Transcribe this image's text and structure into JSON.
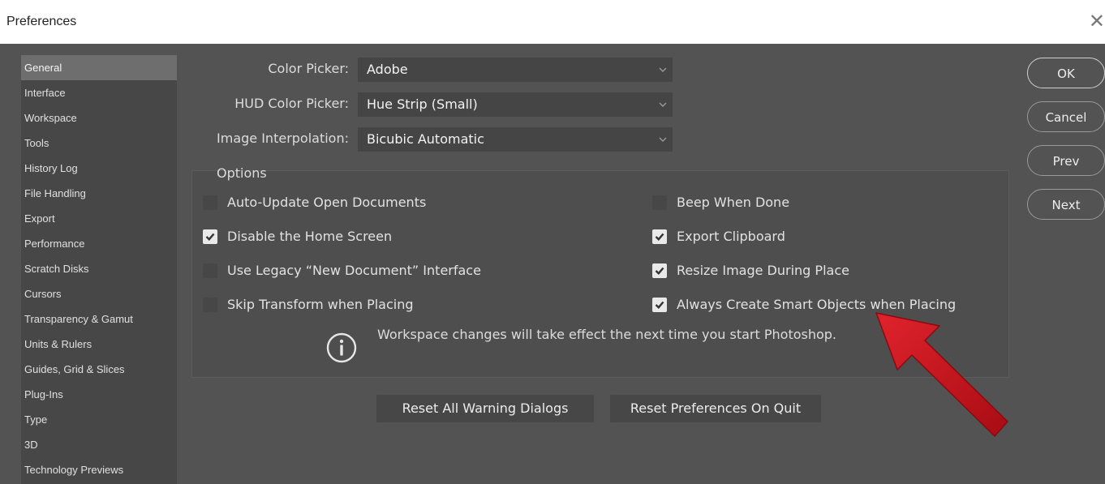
{
  "window": {
    "title": "Preferences",
    "close_glyph": "✕"
  },
  "sidebar": {
    "items": [
      {
        "label": "General",
        "active": true
      },
      {
        "label": "Interface"
      },
      {
        "label": "Workspace"
      },
      {
        "label": "Tools"
      },
      {
        "label": "History Log"
      },
      {
        "label": "File Handling"
      },
      {
        "label": "Export"
      },
      {
        "label": "Performance"
      },
      {
        "label": "Scratch Disks"
      },
      {
        "label": "Cursors"
      },
      {
        "label": "Transparency & Gamut"
      },
      {
        "label": "Units & Rulers"
      },
      {
        "label": "Guides, Grid & Slices"
      },
      {
        "label": "Plug-Ins"
      },
      {
        "label": "Type"
      },
      {
        "label": "3D"
      },
      {
        "label": "Technology Previews"
      }
    ]
  },
  "general": {
    "color_picker": {
      "label": "Color Picker:",
      "value": "Adobe"
    },
    "hud_color_picker": {
      "label": "HUD Color Picker:",
      "value": "Hue Strip (Small)"
    },
    "image_interpolation": {
      "label": "Image Interpolation:",
      "value": "Bicubic Automatic"
    }
  },
  "options": {
    "title": "Options",
    "left": [
      {
        "label": "Auto-Update Open Documents",
        "checked": false
      },
      {
        "label": "Disable the Home Screen",
        "checked": true
      },
      {
        "label": "Use Legacy “New Document” Interface",
        "checked": false
      },
      {
        "label": "Skip Transform when Placing",
        "checked": false
      }
    ],
    "right": [
      {
        "label": "Beep When Done",
        "checked": false
      },
      {
        "label": "Export Clipboard",
        "checked": true
      },
      {
        "label": "Resize Image During Place",
        "checked": true
      },
      {
        "label": "Always Create Smart Objects when Placing",
        "checked": true
      }
    ],
    "info_icon": "info-icon",
    "info_text": "Workspace changes will take effect the next time you start Photoshop."
  },
  "buttons": {
    "reset_warnings": "Reset All Warning Dialogs",
    "reset_prefs": "Reset Preferences On Quit"
  },
  "actions": {
    "ok": "OK",
    "cancel": "Cancel",
    "prev": "Prev",
    "next": "Next"
  },
  "colors": {
    "panel_bg": "#535353",
    "sidebar_bg": "#474747",
    "annotation_arrow": "#c8141e"
  }
}
